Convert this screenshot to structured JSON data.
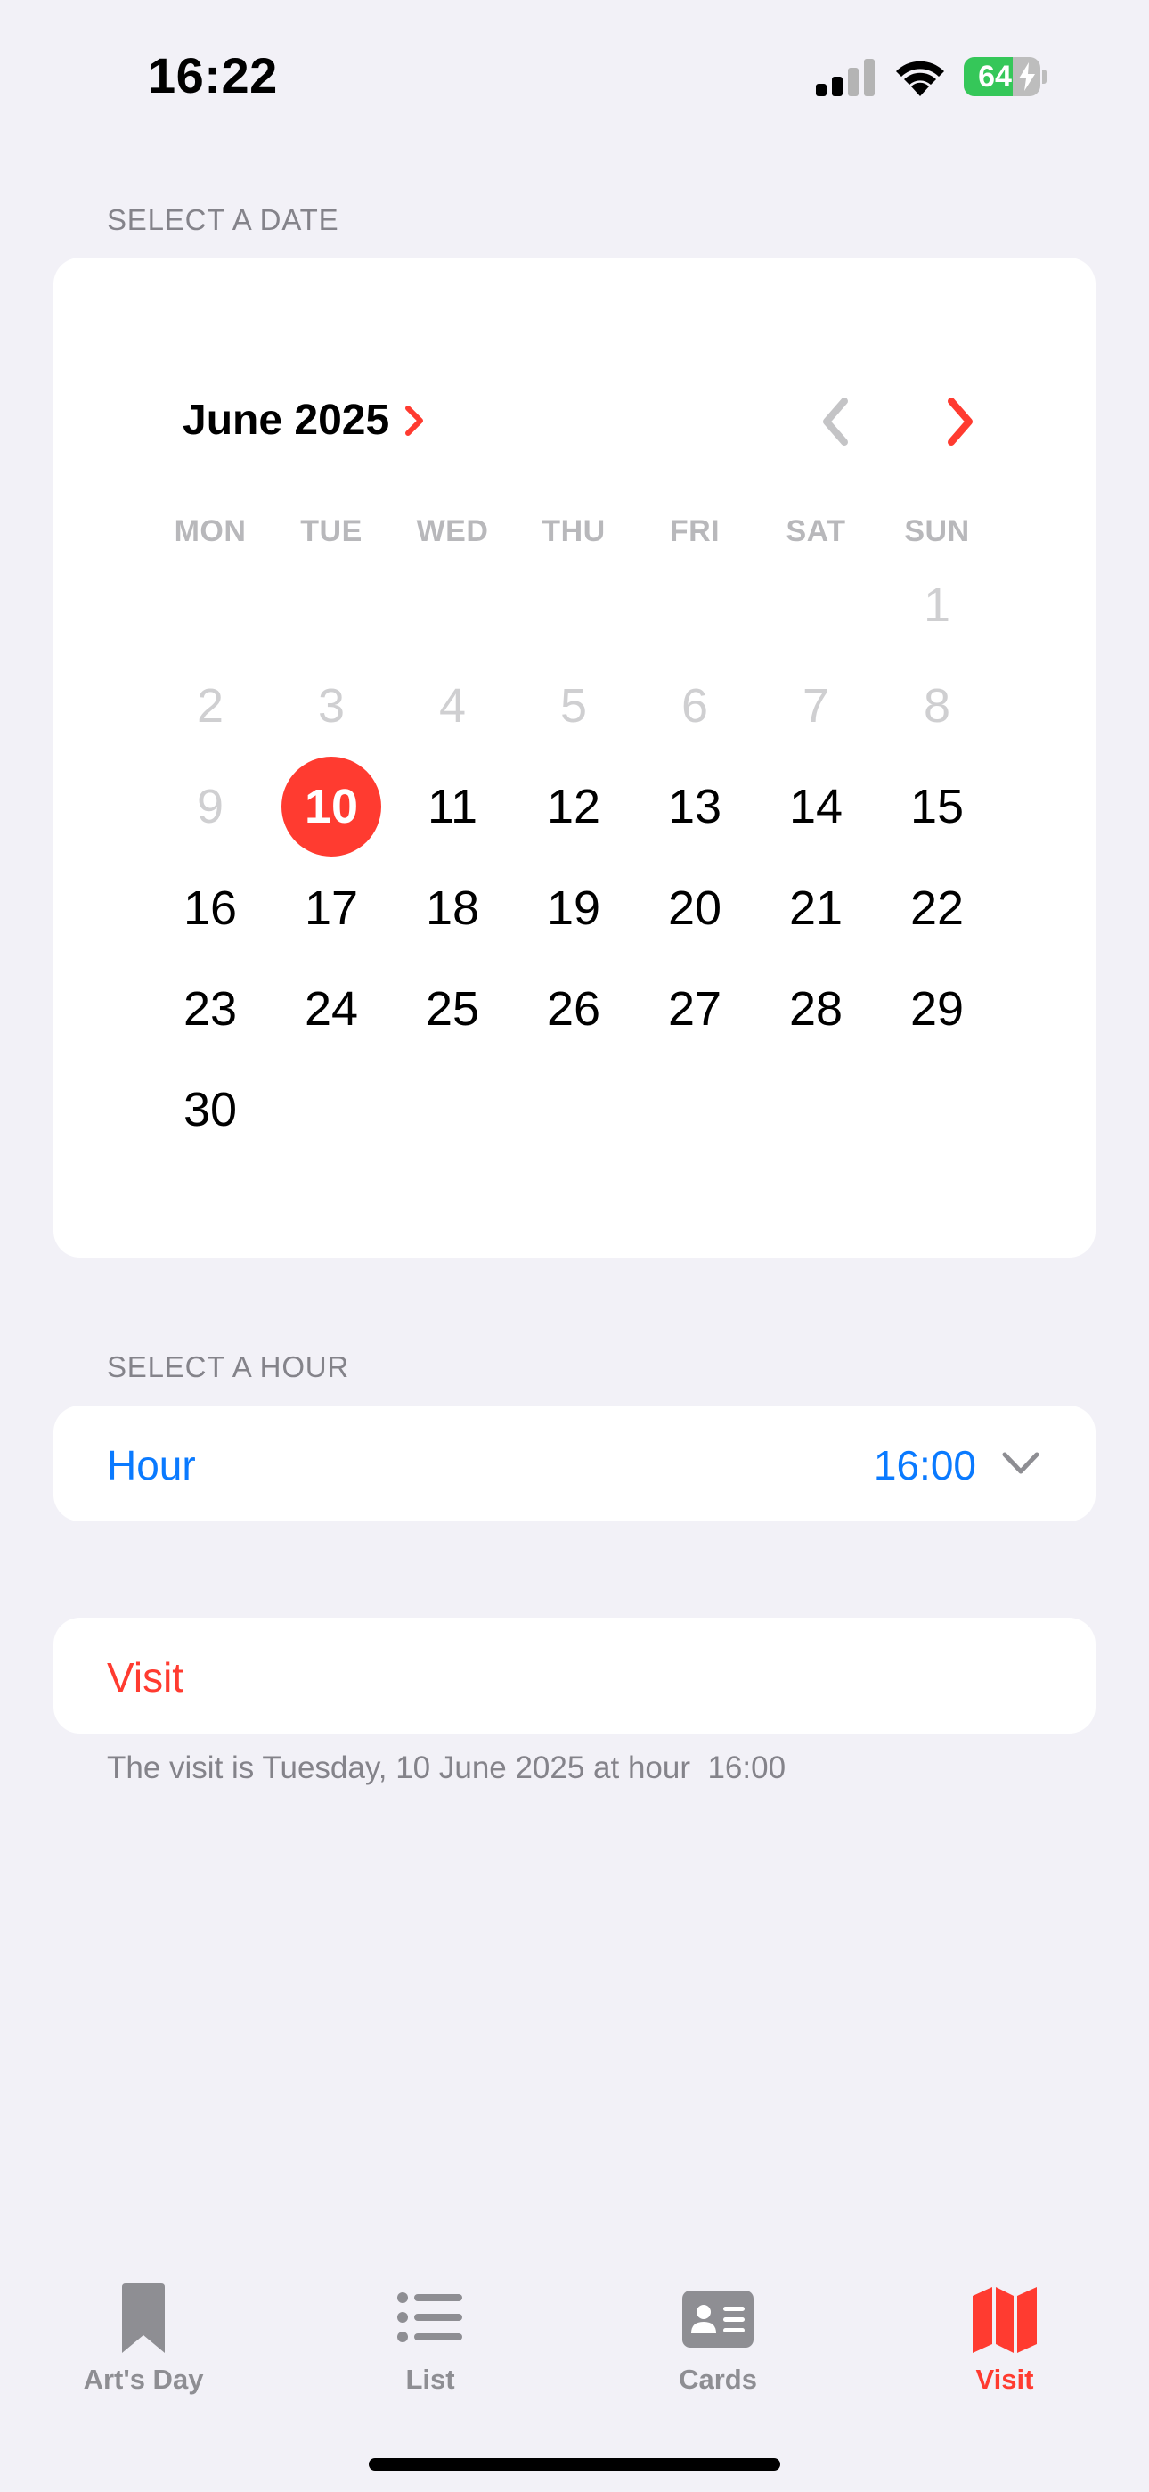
{
  "status_bar": {
    "time": "16:22",
    "battery_level": "64",
    "signal_icon": "cellular-signal-icon",
    "wifi_icon": "wifi-icon",
    "battery_charging": true
  },
  "date_section": {
    "header": "SELECT A DATE",
    "month_label": "June 2025",
    "weekdays": [
      "MON",
      "TUE",
      "WED",
      "THU",
      "FRI",
      "SAT",
      "SUN"
    ],
    "days": [
      {
        "label": "1",
        "state": "past"
      },
      {
        "label": "2",
        "state": "past"
      },
      {
        "label": "3",
        "state": "past"
      },
      {
        "label": "4",
        "state": "past"
      },
      {
        "label": "5",
        "state": "past"
      },
      {
        "label": "6",
        "state": "past"
      },
      {
        "label": "7",
        "state": "past"
      },
      {
        "label": "8",
        "state": "past"
      },
      {
        "label": "9",
        "state": "past"
      },
      {
        "label": "10",
        "state": "selected"
      },
      {
        "label": "11",
        "state": "available"
      },
      {
        "label": "12",
        "state": "available"
      },
      {
        "label": "13",
        "state": "available"
      },
      {
        "label": "14",
        "state": "available"
      },
      {
        "label": "15",
        "state": "available"
      },
      {
        "label": "16",
        "state": "available"
      },
      {
        "label": "17",
        "state": "available"
      },
      {
        "label": "18",
        "state": "available"
      },
      {
        "label": "19",
        "state": "available"
      },
      {
        "label": "20",
        "state": "available"
      },
      {
        "label": "21",
        "state": "available"
      },
      {
        "label": "22",
        "state": "available"
      },
      {
        "label": "23",
        "state": "available"
      },
      {
        "label": "24",
        "state": "available"
      },
      {
        "label": "25",
        "state": "available"
      },
      {
        "label": "26",
        "state": "available"
      },
      {
        "label": "27",
        "state": "available"
      },
      {
        "label": "28",
        "state": "available"
      },
      {
        "label": "29",
        "state": "available"
      },
      {
        "label": "30",
        "state": "available"
      }
    ],
    "first_weekday_index": 6,
    "prev_month_enabled": false,
    "next_month_enabled": true
  },
  "hour_section": {
    "header": "SELECT A HOUR",
    "label": "Hour",
    "value": "16:00"
  },
  "visit_section": {
    "label": "Visit",
    "footer": "The visit is Tuesday, 10 June 2025 at hour  16:00"
  },
  "tab_bar": {
    "tabs": [
      {
        "label": "Art's Day",
        "icon": "bookmark-icon",
        "active": false
      },
      {
        "label": "List",
        "icon": "list-icon",
        "active": false
      },
      {
        "label": "Cards",
        "icon": "contact-card-icon",
        "active": false
      },
      {
        "label": "Visit",
        "icon": "map-icon",
        "active": true
      }
    ]
  },
  "colors": {
    "accent_red": "#ff3b30",
    "accent_blue": "#0a7aff",
    "background": "#f2f1f7",
    "secondary_text": "#84838a",
    "disabled_day": "#cfcfd1",
    "tab_inactive": "#8e8e93"
  }
}
